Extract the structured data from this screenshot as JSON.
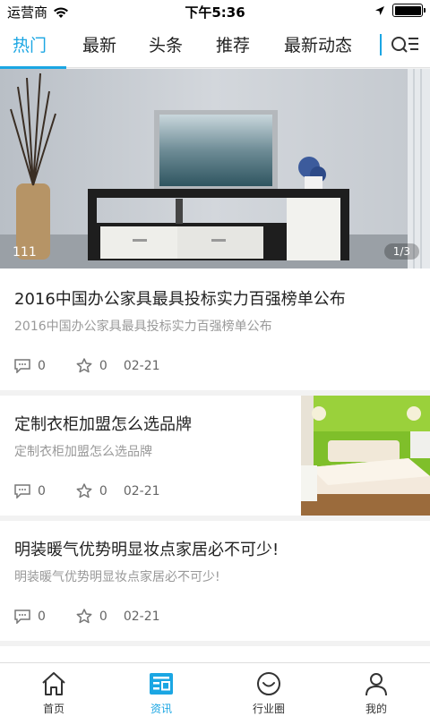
{
  "status_bar": {
    "carrier": "运营商",
    "time": "下午5:36"
  },
  "tabs": [
    {
      "label": "热门",
      "active": true
    },
    {
      "label": "最新",
      "active": false
    },
    {
      "label": "头条",
      "active": false
    },
    {
      "label": "推荐",
      "active": false
    },
    {
      "label": "最新动态",
      "active": false
    }
  ],
  "banner": {
    "caption": "111",
    "pager": "1/3"
  },
  "news": [
    {
      "title": "2016中国办公家具最具投标实力百强榜单公布",
      "summary": "2016中国办公家具最具投标实力百强榜单公布",
      "comments": "0",
      "likes": "0",
      "date": "02-21"
    },
    {
      "title": "定制衣柜加盟怎么选品牌",
      "summary": "定制衣柜加盟怎么选品牌",
      "comments": "0",
      "likes": "0",
      "date": "02-21"
    },
    {
      "title": "明装暖气优势明显妆点家居必不可少!",
      "summary": "明装暖气优势明显妆点家居必不可少!",
      "comments": "0",
      "likes": "0",
      "date": "02-21"
    }
  ],
  "bottom_nav": [
    {
      "label": "首页",
      "icon": "home-icon",
      "active": false
    },
    {
      "label": "资讯",
      "icon": "news-icon",
      "active": true
    },
    {
      "label": "行业圈",
      "icon": "smile-icon",
      "active": false
    },
    {
      "label": "我的",
      "icon": "user-icon",
      "active": false
    }
  ],
  "colors": {
    "accent": "#1ba6e3"
  }
}
